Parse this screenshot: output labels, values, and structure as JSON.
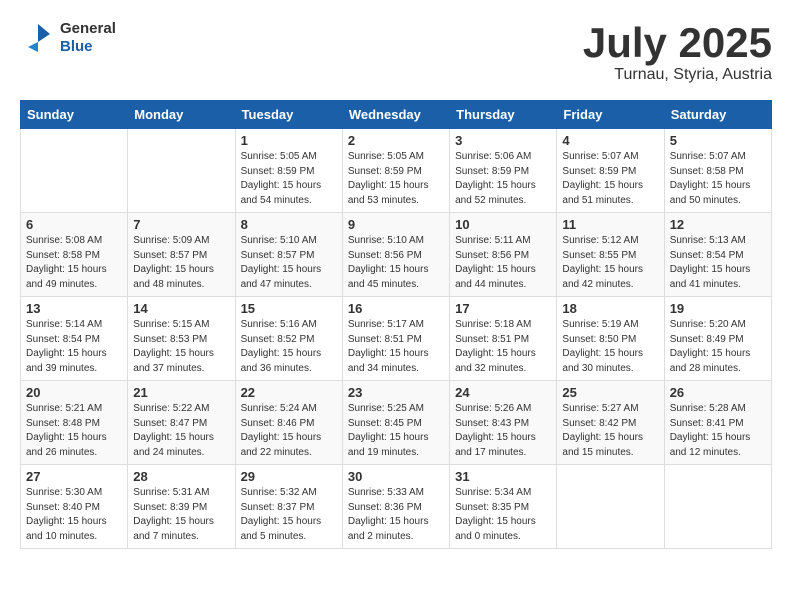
{
  "header": {
    "logo_general": "General",
    "logo_blue": "Blue",
    "month_year": "July 2025",
    "location": "Turnau, Styria, Austria"
  },
  "weekdays": [
    "Sunday",
    "Monday",
    "Tuesday",
    "Wednesday",
    "Thursday",
    "Friday",
    "Saturday"
  ],
  "weeks": [
    [
      {
        "day": "",
        "sunrise": "",
        "sunset": "",
        "daylight": ""
      },
      {
        "day": "",
        "sunrise": "",
        "sunset": "",
        "daylight": ""
      },
      {
        "day": "1",
        "sunrise": "Sunrise: 5:05 AM",
        "sunset": "Sunset: 8:59 PM",
        "daylight": "Daylight: 15 hours and 54 minutes."
      },
      {
        "day": "2",
        "sunrise": "Sunrise: 5:05 AM",
        "sunset": "Sunset: 8:59 PM",
        "daylight": "Daylight: 15 hours and 53 minutes."
      },
      {
        "day": "3",
        "sunrise": "Sunrise: 5:06 AM",
        "sunset": "Sunset: 8:59 PM",
        "daylight": "Daylight: 15 hours and 52 minutes."
      },
      {
        "day": "4",
        "sunrise": "Sunrise: 5:07 AM",
        "sunset": "Sunset: 8:59 PM",
        "daylight": "Daylight: 15 hours and 51 minutes."
      },
      {
        "day": "5",
        "sunrise": "Sunrise: 5:07 AM",
        "sunset": "Sunset: 8:58 PM",
        "daylight": "Daylight: 15 hours and 50 minutes."
      }
    ],
    [
      {
        "day": "6",
        "sunrise": "Sunrise: 5:08 AM",
        "sunset": "Sunset: 8:58 PM",
        "daylight": "Daylight: 15 hours and 49 minutes."
      },
      {
        "day": "7",
        "sunrise": "Sunrise: 5:09 AM",
        "sunset": "Sunset: 8:57 PM",
        "daylight": "Daylight: 15 hours and 48 minutes."
      },
      {
        "day": "8",
        "sunrise": "Sunrise: 5:10 AM",
        "sunset": "Sunset: 8:57 PM",
        "daylight": "Daylight: 15 hours and 47 minutes."
      },
      {
        "day": "9",
        "sunrise": "Sunrise: 5:10 AM",
        "sunset": "Sunset: 8:56 PM",
        "daylight": "Daylight: 15 hours and 45 minutes."
      },
      {
        "day": "10",
        "sunrise": "Sunrise: 5:11 AM",
        "sunset": "Sunset: 8:56 PM",
        "daylight": "Daylight: 15 hours and 44 minutes."
      },
      {
        "day": "11",
        "sunrise": "Sunrise: 5:12 AM",
        "sunset": "Sunset: 8:55 PM",
        "daylight": "Daylight: 15 hours and 42 minutes."
      },
      {
        "day": "12",
        "sunrise": "Sunrise: 5:13 AM",
        "sunset": "Sunset: 8:54 PM",
        "daylight": "Daylight: 15 hours and 41 minutes."
      }
    ],
    [
      {
        "day": "13",
        "sunrise": "Sunrise: 5:14 AM",
        "sunset": "Sunset: 8:54 PM",
        "daylight": "Daylight: 15 hours and 39 minutes."
      },
      {
        "day": "14",
        "sunrise": "Sunrise: 5:15 AM",
        "sunset": "Sunset: 8:53 PM",
        "daylight": "Daylight: 15 hours and 37 minutes."
      },
      {
        "day": "15",
        "sunrise": "Sunrise: 5:16 AM",
        "sunset": "Sunset: 8:52 PM",
        "daylight": "Daylight: 15 hours and 36 minutes."
      },
      {
        "day": "16",
        "sunrise": "Sunrise: 5:17 AM",
        "sunset": "Sunset: 8:51 PM",
        "daylight": "Daylight: 15 hours and 34 minutes."
      },
      {
        "day": "17",
        "sunrise": "Sunrise: 5:18 AM",
        "sunset": "Sunset: 8:51 PM",
        "daylight": "Daylight: 15 hours and 32 minutes."
      },
      {
        "day": "18",
        "sunrise": "Sunrise: 5:19 AM",
        "sunset": "Sunset: 8:50 PM",
        "daylight": "Daylight: 15 hours and 30 minutes."
      },
      {
        "day": "19",
        "sunrise": "Sunrise: 5:20 AM",
        "sunset": "Sunset: 8:49 PM",
        "daylight": "Daylight: 15 hours and 28 minutes."
      }
    ],
    [
      {
        "day": "20",
        "sunrise": "Sunrise: 5:21 AM",
        "sunset": "Sunset: 8:48 PM",
        "daylight": "Daylight: 15 hours and 26 minutes."
      },
      {
        "day": "21",
        "sunrise": "Sunrise: 5:22 AM",
        "sunset": "Sunset: 8:47 PM",
        "daylight": "Daylight: 15 hours and 24 minutes."
      },
      {
        "day": "22",
        "sunrise": "Sunrise: 5:24 AM",
        "sunset": "Sunset: 8:46 PM",
        "daylight": "Daylight: 15 hours and 22 minutes."
      },
      {
        "day": "23",
        "sunrise": "Sunrise: 5:25 AM",
        "sunset": "Sunset: 8:45 PM",
        "daylight": "Daylight: 15 hours and 19 minutes."
      },
      {
        "day": "24",
        "sunrise": "Sunrise: 5:26 AM",
        "sunset": "Sunset: 8:43 PM",
        "daylight": "Daylight: 15 hours and 17 minutes."
      },
      {
        "day": "25",
        "sunrise": "Sunrise: 5:27 AM",
        "sunset": "Sunset: 8:42 PM",
        "daylight": "Daylight: 15 hours and 15 minutes."
      },
      {
        "day": "26",
        "sunrise": "Sunrise: 5:28 AM",
        "sunset": "Sunset: 8:41 PM",
        "daylight": "Daylight: 15 hours and 12 minutes."
      }
    ],
    [
      {
        "day": "27",
        "sunrise": "Sunrise: 5:30 AM",
        "sunset": "Sunset: 8:40 PM",
        "daylight": "Daylight: 15 hours and 10 minutes."
      },
      {
        "day": "28",
        "sunrise": "Sunrise: 5:31 AM",
        "sunset": "Sunset: 8:39 PM",
        "daylight": "Daylight: 15 hours and 7 minutes."
      },
      {
        "day": "29",
        "sunrise": "Sunrise: 5:32 AM",
        "sunset": "Sunset: 8:37 PM",
        "daylight": "Daylight: 15 hours and 5 minutes."
      },
      {
        "day": "30",
        "sunrise": "Sunrise: 5:33 AM",
        "sunset": "Sunset: 8:36 PM",
        "daylight": "Daylight: 15 hours and 2 minutes."
      },
      {
        "day": "31",
        "sunrise": "Sunrise: 5:34 AM",
        "sunset": "Sunset: 8:35 PM",
        "daylight": "Daylight: 15 hours and 0 minutes."
      },
      {
        "day": "",
        "sunrise": "",
        "sunset": "",
        "daylight": ""
      },
      {
        "day": "",
        "sunrise": "",
        "sunset": "",
        "daylight": ""
      }
    ]
  ]
}
